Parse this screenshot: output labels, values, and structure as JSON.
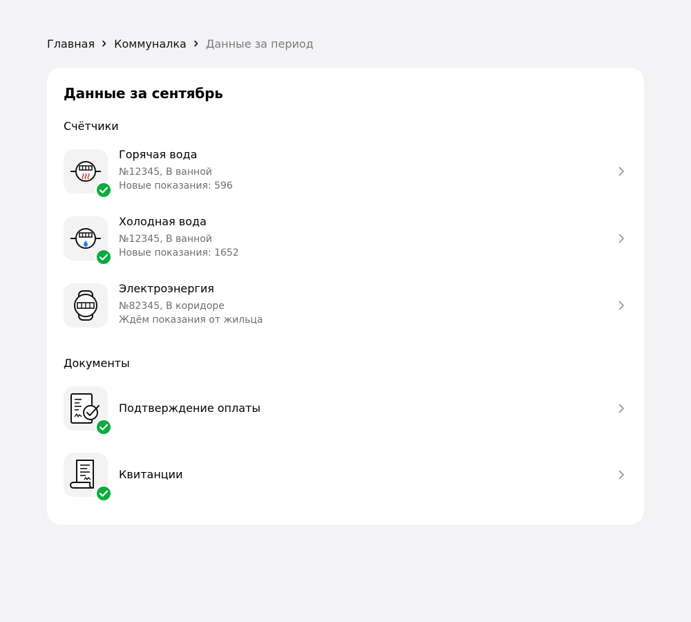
{
  "breadcrumb": {
    "items": [
      "Главная",
      "Коммуналка",
      "Данные за период"
    ]
  },
  "card": {
    "title": "Данные за сентябрь"
  },
  "meters": {
    "section_title": "Счётчики",
    "items": [
      {
        "title": "Горячая вода",
        "number_location": "№12345, В ванной",
        "status": "Новые показания: 596",
        "icon": "hot-water-meter-icon",
        "confirmed": true
      },
      {
        "title": "Холодная вода",
        "number_location": "№12345, В ванной",
        "status": "Новые показания: 1652",
        "icon": "cold-water-meter-icon",
        "confirmed": true
      },
      {
        "title": "Электроэнергия",
        "number_location": "№82345, В коридоре",
        "status": "Ждём показания от жильца",
        "icon": "electricity-meter-icon",
        "confirmed": false
      }
    ]
  },
  "documents": {
    "section_title": "Документы",
    "items": [
      {
        "title": "Подтверждение оплаты",
        "icon": "payment-confirmation-document-icon",
        "confirmed": true
      },
      {
        "title": "Квитанции",
        "icon": "receipt-scroll-icon",
        "confirmed": true
      }
    ]
  },
  "colors": {
    "background": "#f3f3f6",
    "card": "#ffffff",
    "tile": "#f3f3f3",
    "check_green": "#0bab3f",
    "hot_red": "#e8352b",
    "cold_blue": "#2a7de1",
    "secondary_text": "#6f6f6f"
  }
}
